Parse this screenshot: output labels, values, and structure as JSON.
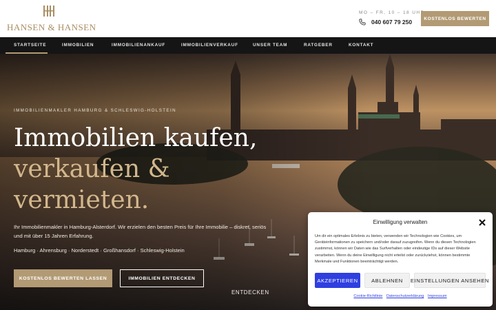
{
  "brand": {
    "name": "HANSEN & HANSEN",
    "accent": "#b29a74"
  },
  "header": {
    "hours": "MO – FR, 10 – 18 UHR",
    "phone": "040 607 79 250",
    "cta": "KOSTENLOS BEWERTEN"
  },
  "nav": {
    "items": [
      {
        "label": "STARTSEITE",
        "active": true
      },
      {
        "label": "IMMOBILIEN"
      },
      {
        "label": "IMMOBILIENANKAUF"
      },
      {
        "label": "IMMOBILIENVERKAUF"
      },
      {
        "label": "UNSER TEAM"
      },
      {
        "label": "RATGEBER"
      },
      {
        "label": "KONTAKT"
      }
    ]
  },
  "hero": {
    "eyebrow": "IMMOBILIENMAKLER HAMBURG & SCHLESWIG-HOLSTEIN",
    "headline_line1": "Immobilien kaufen,",
    "headline_line2": "verkaufen &",
    "headline_line3": "vermieten.",
    "intro": "Ihr Immobilienmakler in Hamburg-Alsterdorf. Wir erzielen den besten Preis für Ihre Immobilie – diskret, seriös und mit über 15 Jahren Erfahrung.",
    "regions": "Hamburg · Ahrensburg · Norderstedt · Großhansdorf · Schleswig-Holstein",
    "btn_primary": "KOSTENLOS BEWERTEN LASSEN",
    "btn_secondary": "IMMOBILIEN ENTDECKEN",
    "discover": "ENTDECKEN"
  },
  "cookie": {
    "title": "Einwilligung verwalten",
    "body": "Um dir ein optimales Erlebnis zu bieten, verwenden wir Technologien wie Cookies, um Geräteinformationen zu speichern und/oder darauf zuzugreifen. Wenn du diesen Technologien zustimmst, können wir Daten wie das Surfverhalten oder eindeutige IDs auf dieser Website verarbeiten. Wenn du deine Einwilligung nicht erteilst oder zurückziehst, können bestimmte Merkmale und Funktionen beeinträchtigt werden.",
    "accept": "AKZEPTIEREN",
    "deny": "ABLEHNEN",
    "settings": "EINSTELLUNGEN ANSEHEN",
    "link_cookie": "Cookie-Richtlinie",
    "link_privacy": "Datenschutzerklärung",
    "link_imprint": "Impressum",
    "accept_color": "#2f3fe0"
  }
}
